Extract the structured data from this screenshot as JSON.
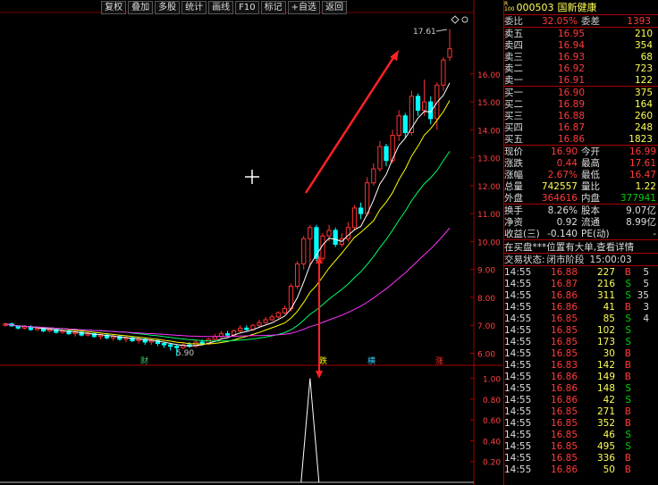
{
  "toolbar": [
    "复权",
    "叠加",
    "多股",
    "统计",
    "画线",
    "F10",
    "标记",
    "+自选",
    "返回"
  ],
  "stock": {
    "code": "000503",
    "name": "国新健康",
    "badge_top": "R",
    "badge_bottom": "100"
  },
  "quote_head": {
    "wei_bi_label": "委比",
    "wei_bi": "32.05%",
    "wei_cha_label": "委差",
    "wei_cha": "1393"
  },
  "sell_orders": [
    {
      "label": "卖五",
      "price": "16.95",
      "vol": "210"
    },
    {
      "label": "卖四",
      "price": "16.94",
      "vol": "354"
    },
    {
      "label": "卖三",
      "price": "16.93",
      "vol": "68"
    },
    {
      "label": "卖二",
      "price": "16.92",
      "vol": "723"
    },
    {
      "label": "卖一",
      "price": "16.91",
      "vol": "122"
    }
  ],
  "buy_orders": [
    {
      "label": "买一",
      "price": "16.90",
      "vol": "375"
    },
    {
      "label": "买二",
      "price": "16.89",
      "vol": "164"
    },
    {
      "label": "买三",
      "price": "16.88",
      "vol": "260"
    },
    {
      "label": "买四",
      "price": "16.87",
      "vol": "248"
    },
    {
      "label": "买五",
      "price": "16.86",
      "vol": "1823"
    }
  ],
  "stats": [
    {
      "l1": "现价",
      "v1": "16.90",
      "c1": "red",
      "l2": "今开",
      "v2": "16.99",
      "c2": "red"
    },
    {
      "l1": "涨跌",
      "v1": "0.44",
      "c1": "red",
      "l2": "最高",
      "v2": "17.61",
      "c2": "red"
    },
    {
      "l1": "涨幅",
      "v1": "2.67%",
      "c1": "red",
      "l2": "最低",
      "v2": "16.47",
      "c2": "red"
    },
    {
      "l1": "总量",
      "v1": "742557",
      "c1": "yel",
      "l2": "量比",
      "v2": "1.22",
      "c2": "yel"
    },
    {
      "l1": "外盘",
      "v1": "364616",
      "c1": "red",
      "l2": "内盘",
      "v2": "377941",
      "c2": "green"
    }
  ],
  "stats2": [
    {
      "l1": "换手",
      "v1": "8.26%",
      "c1": "wht",
      "l2": "股本",
      "v2": "9.07亿",
      "c2": "wht"
    },
    {
      "l1": "净资",
      "v1": "0.92",
      "c1": "wht",
      "l2": "流通",
      "v2": "8.99亿",
      "c2": "wht"
    },
    {
      "l1": "收益(三)",
      "v1": "-0.140",
      "c1": "wht",
      "l2": "PE(动)",
      "v2": "-",
      "c2": "wht"
    }
  ],
  "notice": "在买盘***位置有大单,查看详情",
  "trade_state": {
    "label": "交易状态:",
    "value": "闭市阶段",
    "time": "15:00:03"
  },
  "ticks": [
    {
      "t": "14:55",
      "p": "16.88",
      "v": "227",
      "s": "B"
    },
    {
      "t": "14:55",
      "p": "16.87",
      "v": "216",
      "s": "S"
    },
    {
      "t": "14:55",
      "p": "16.86",
      "v": "311",
      "s": "S"
    },
    {
      "t": "14:55",
      "p": "16.86",
      "v": "41",
      "s": "B"
    },
    {
      "t": "14:55",
      "p": "16.85",
      "v": "85",
      "s": "S"
    },
    {
      "t": "14:55",
      "p": "16.85",
      "v": "102",
      "s": "S"
    },
    {
      "t": "14:55",
      "p": "16.85",
      "v": "173",
      "s": "S"
    },
    {
      "t": "14:55",
      "p": "16.85",
      "v": "30",
      "s": "B"
    },
    {
      "t": "14:55",
      "p": "16.83",
      "v": "142",
      "s": "B"
    },
    {
      "t": "14:55",
      "p": "16.86",
      "v": "149",
      "s": "B"
    },
    {
      "t": "14:55",
      "p": "16.86",
      "v": "148",
      "s": "S"
    },
    {
      "t": "14:55",
      "p": "16.86",
      "v": "42",
      "s": "S"
    },
    {
      "t": "14:55",
      "p": "16.85",
      "v": "271",
      "s": "B"
    },
    {
      "t": "14:55",
      "p": "16.85",
      "v": "352",
      "s": "B"
    },
    {
      "t": "14:55",
      "p": "16.85",
      "v": "46",
      "s": "S"
    },
    {
      "t": "14:55",
      "p": "16.85",
      "v": "495",
      "s": "S"
    },
    {
      "t": "14:55",
      "p": "16.85",
      "v": "336",
      "s": "B"
    },
    {
      "t": "14:55",
      "p": "16.86",
      "v": "50",
      "s": "B"
    }
  ],
  "tick_counts": [
    "5",
    "5",
    "35",
    "3",
    "4",
    "",
    "",
    "",
    "",
    "",
    "",
    "",
    "",
    "",
    "",
    "",
    "",
    ""
  ],
  "chart": {
    "price_ticks": [
      "16.00",
      "15.00",
      "14.00",
      "13.00",
      "12.00",
      "11.00",
      "10.00",
      "9.00",
      "8.00",
      "7.00",
      "6.00"
    ],
    "vol_ticks": [
      "1.00",
      "0.80",
      "0.60",
      "0.40",
      "0.20"
    ],
    "high_label": "17.61",
    "low_label": "5.90",
    "markers": [
      "财",
      "跌",
      "横",
      "涨"
    ],
    "colors": {
      "up": "#ff3333",
      "down": "#00ffff",
      "ma5": "#ffffff",
      "ma10": "#ffff00",
      "ma20": "#00ff66",
      "ma60": "#ff33ff",
      "arrow": "#ff2222"
    }
  },
  "chart_data": {
    "type": "candlestick",
    "ylim": [
      5.6,
      18.2
    ],
    "vol_ylim": [
      0,
      1.1
    ],
    "candles": [
      [
        7.0,
        7.05,
        6.95,
        7.1
      ],
      [
        7.05,
        6.98,
        6.95,
        7.1
      ],
      [
        6.98,
        6.9,
        6.85,
        7.0
      ],
      [
        6.9,
        6.95,
        6.85,
        7.0
      ],
      [
        6.95,
        6.85,
        6.8,
        7.0
      ],
      [
        6.85,
        6.9,
        6.8,
        6.95
      ],
      [
        6.9,
        6.8,
        6.75,
        6.95
      ],
      [
        6.8,
        6.85,
        6.75,
        6.9
      ],
      [
        6.85,
        6.75,
        6.7,
        6.9
      ],
      [
        6.75,
        6.8,
        6.7,
        6.85
      ],
      [
        6.8,
        6.7,
        6.65,
        6.85
      ],
      [
        6.7,
        6.75,
        6.6,
        6.8
      ],
      [
        6.75,
        6.65,
        6.6,
        6.8
      ],
      [
        6.65,
        6.7,
        6.6,
        6.75
      ],
      [
        6.7,
        6.6,
        6.55,
        6.75
      ],
      [
        6.6,
        6.65,
        6.5,
        6.7
      ],
      [
        6.65,
        6.55,
        6.5,
        6.7
      ],
      [
        6.55,
        6.6,
        6.45,
        6.65
      ],
      [
        6.6,
        6.5,
        6.45,
        6.65
      ],
      [
        6.5,
        6.55,
        6.4,
        6.6
      ],
      [
        6.55,
        6.45,
        6.4,
        6.6
      ],
      [
        6.45,
        6.5,
        6.35,
        6.55
      ],
      [
        6.5,
        6.4,
        6.3,
        6.55
      ],
      [
        6.4,
        6.45,
        6.3,
        6.5
      ],
      [
        6.45,
        6.35,
        6.25,
        6.5
      ],
      [
        6.35,
        6.3,
        6.2,
        6.4
      ],
      [
        6.3,
        6.25,
        6.1,
        6.35
      ],
      [
        6.25,
        6.2,
        5.9,
        6.3
      ],
      [
        6.2,
        6.3,
        6.15,
        6.35
      ],
      [
        6.3,
        6.25,
        6.2,
        6.4
      ],
      [
        6.25,
        6.4,
        6.2,
        6.45
      ],
      [
        6.4,
        6.35,
        6.3,
        6.5
      ],
      [
        6.35,
        6.5,
        6.3,
        6.55
      ],
      [
        6.5,
        6.6,
        6.45,
        6.7
      ],
      [
        6.6,
        6.7,
        6.55,
        6.8
      ],
      [
        6.7,
        6.65,
        6.6,
        6.8
      ],
      [
        6.65,
        6.8,
        6.6,
        6.85
      ],
      [
        6.8,
        6.9,
        6.75,
        7.0
      ],
      [
        6.9,
        6.85,
        6.8,
        7.0
      ],
      [
        6.85,
        7.0,
        6.8,
        7.05
      ],
      [
        7.0,
        7.1,
        6.95,
        7.2
      ],
      [
        7.1,
        7.2,
        7.05,
        7.3
      ],
      [
        7.2,
        7.3,
        7.15,
        7.4
      ],
      [
        7.3,
        7.45,
        7.25,
        7.5
      ],
      [
        7.45,
        7.6,
        7.4,
        7.7
      ],
      [
        7.6,
        8.4,
        7.5,
        8.5
      ],
      [
        8.4,
        9.2,
        8.3,
        9.3
      ],
      [
        9.2,
        10.1,
        9.0,
        10.2
      ],
      [
        10.1,
        10.5,
        9.1,
        10.6
      ],
      [
        10.5,
        9.4,
        9.3,
        10.6
      ],
      [
        9.4,
        10.2,
        9.3,
        10.3
      ],
      [
        10.2,
        10.4,
        10.0,
        10.6
      ],
      [
        10.4,
        9.9,
        9.8,
        10.5
      ],
      [
        9.9,
        10.1,
        9.8,
        10.3
      ],
      [
        10.1,
        10.5,
        10.0,
        10.7
      ],
      [
        10.5,
        11.2,
        10.4,
        11.3
      ],
      [
        11.2,
        11.0,
        10.8,
        11.4
      ],
      [
        11.0,
        12.1,
        10.9,
        12.3
      ],
      [
        12.1,
        12.6,
        12.0,
        12.8
      ],
      [
        12.6,
        13.4,
        12.5,
        13.6
      ],
      [
        13.4,
        12.9,
        12.7,
        13.5
      ],
      [
        12.9,
        13.8,
        12.8,
        14.0
      ],
      [
        13.8,
        14.5,
        13.6,
        14.7
      ],
      [
        14.5,
        13.9,
        13.7,
        14.6
      ],
      [
        13.9,
        15.2,
        13.8,
        15.4
      ],
      [
        15.2,
        14.7,
        14.5,
        15.3
      ],
      [
        14.7,
        15.0,
        14.5,
        15.8
      ],
      [
        15.0,
        14.4,
        14.2,
        15.2
      ],
      [
        14.4,
        15.6,
        14.0,
        15.7
      ],
      [
        15.6,
        16.5,
        15.4,
        16.6
      ],
      [
        16.6,
        16.9,
        16.47,
        17.61
      ]
    ],
    "volume_peak": 1.0
  }
}
